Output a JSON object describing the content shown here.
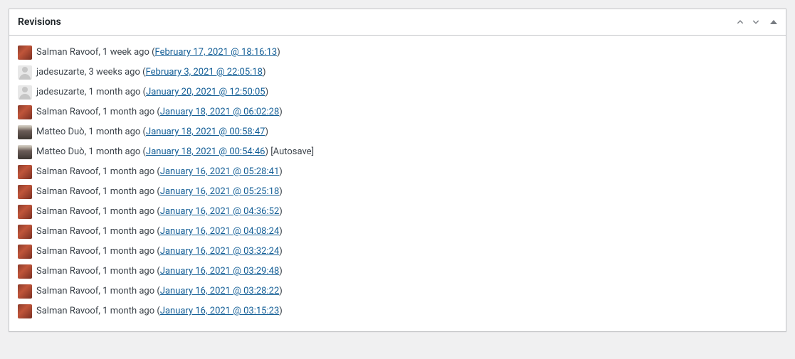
{
  "panel": {
    "title": "Revisions"
  },
  "revisions": [
    {
      "author": "Salman Ravoof",
      "avatar": "salman",
      "ago": "1 week ago",
      "timestamp": "February 17, 2021 @ 18:16:13",
      "suffix": ""
    },
    {
      "author": "jadesuzarte",
      "avatar": "default",
      "ago": "3 weeks ago",
      "timestamp": "February 3, 2021 @ 22:05:18",
      "suffix": ""
    },
    {
      "author": "jadesuzarte",
      "avatar": "default",
      "ago": "1 month ago",
      "timestamp": "January 20, 2021 @ 12:50:05",
      "suffix": ""
    },
    {
      "author": "Salman Ravoof",
      "avatar": "salman",
      "ago": "1 month ago",
      "timestamp": "January 18, 2021 @ 06:02:28",
      "suffix": ""
    },
    {
      "author": "Matteo Duò",
      "avatar": "matteo",
      "ago": "1 month ago",
      "timestamp": "January 18, 2021 @ 00:58:47",
      "suffix": ""
    },
    {
      "author": "Matteo Duò",
      "avatar": "matteo",
      "ago": "1 month ago",
      "timestamp": "January 18, 2021 @ 00:54:46",
      "suffix": " [Autosave]"
    },
    {
      "author": "Salman Ravoof",
      "avatar": "salman",
      "ago": "1 month ago",
      "timestamp": "January 16, 2021 @ 05:28:41",
      "suffix": ""
    },
    {
      "author": "Salman Ravoof",
      "avatar": "salman",
      "ago": "1 month ago",
      "timestamp": "January 16, 2021 @ 05:25:18",
      "suffix": ""
    },
    {
      "author": "Salman Ravoof",
      "avatar": "salman",
      "ago": "1 month ago",
      "timestamp": "January 16, 2021 @ 04:36:52",
      "suffix": ""
    },
    {
      "author": "Salman Ravoof",
      "avatar": "salman",
      "ago": "1 month ago",
      "timestamp": "January 16, 2021 @ 04:08:24",
      "suffix": ""
    },
    {
      "author": "Salman Ravoof",
      "avatar": "salman",
      "ago": "1 month ago",
      "timestamp": "January 16, 2021 @ 03:32:24",
      "suffix": ""
    },
    {
      "author": "Salman Ravoof",
      "avatar": "salman",
      "ago": "1 month ago",
      "timestamp": "January 16, 2021 @ 03:29:48",
      "suffix": ""
    },
    {
      "author": "Salman Ravoof",
      "avatar": "salman",
      "ago": "1 month ago",
      "timestamp": "January 16, 2021 @ 03:28:22",
      "suffix": ""
    },
    {
      "author": "Salman Ravoof",
      "avatar": "salman",
      "ago": "1 month ago",
      "timestamp": "January 16, 2021 @ 03:15:23",
      "suffix": ""
    }
  ]
}
